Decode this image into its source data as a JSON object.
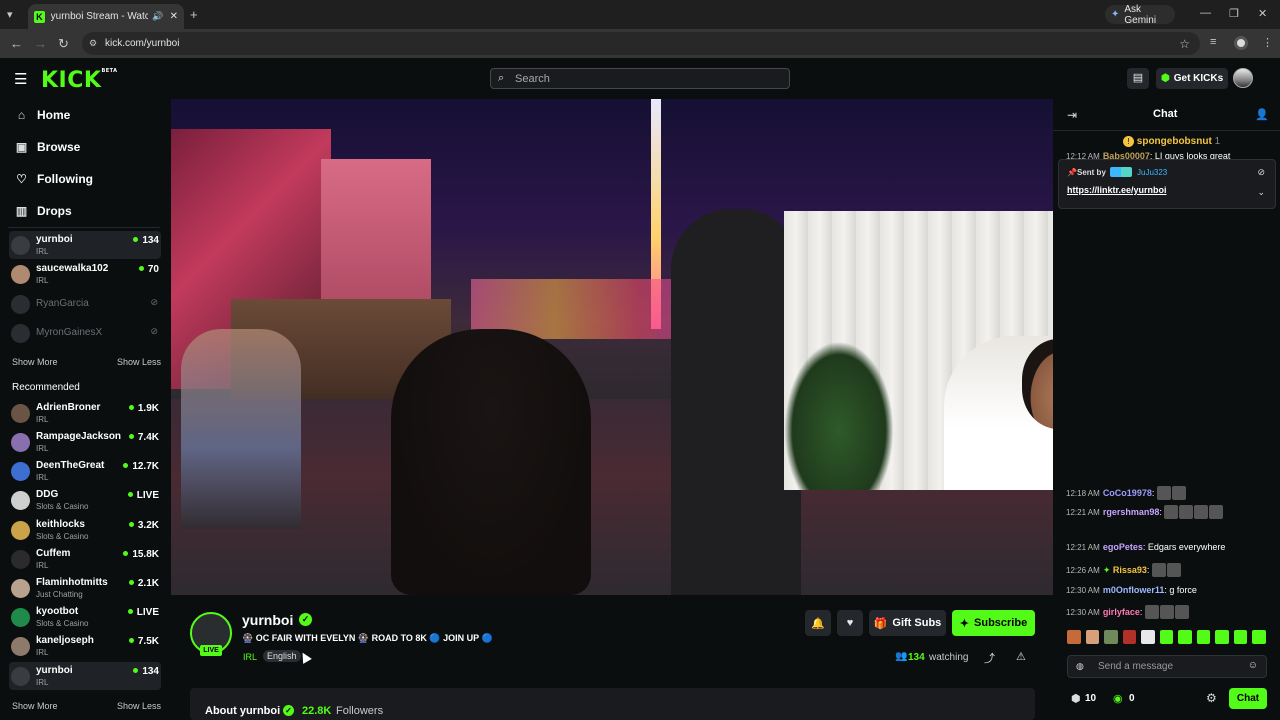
{
  "browser": {
    "tab_title": "yurnboi Stream - Watch Live",
    "url": "kick.com/yurnboi",
    "ask_gemini": "Ask Gemini"
  },
  "header": {
    "logo": "KICK",
    "logo_badge": "BETA",
    "search_placeholder": "Search",
    "get_kicks": "Get KICKs"
  },
  "sidebar": {
    "nav": [
      "Home",
      "Browse",
      "Following",
      "Drops"
    ],
    "following": [
      {
        "name": "yurnboi",
        "category": "IRL",
        "viewers": "134"
      },
      {
        "name": "saucewalka102",
        "category": "IRL",
        "viewers": "70"
      },
      {
        "name": "RyanGarcia",
        "category": "",
        "viewers": ""
      },
      {
        "name": "MyronGainesX",
        "category": "",
        "viewers": ""
      }
    ],
    "show_more": "Show More",
    "show_less": "Show Less",
    "recommended_heading": "Recommended",
    "recommended": [
      {
        "name": "AdrienBroner",
        "category": "IRL",
        "viewers": "1.9K"
      },
      {
        "name": "RampageJackson",
        "category": "IRL",
        "viewers": "7.4K"
      },
      {
        "name": "DeenTheGreat",
        "category": "IRL",
        "viewers": "12.7K"
      },
      {
        "name": "DDG",
        "category": "Slots & Casino",
        "viewers": "LIVE"
      },
      {
        "name": "keithlocks",
        "category": "Slots & Casino",
        "viewers": "3.2K"
      },
      {
        "name": "Cuffem",
        "category": "IRL",
        "viewers": "15.8K"
      },
      {
        "name": "Flaminhotmitts",
        "category": "Just Chatting",
        "viewers": "2.1K"
      },
      {
        "name": "kyootbot",
        "category": "Slots & Casino",
        "viewers": "LIVE"
      },
      {
        "name": "kaneljoseph",
        "category": "IRL",
        "viewers": "7.5K"
      },
      {
        "name": "yurnboi",
        "category": "IRL",
        "viewers": "134"
      }
    ]
  },
  "stream": {
    "streamer": "yurnboi",
    "live_badge": "LIVE",
    "title": "🎡 OC FAIR WITH EVELYN 🎡 ROAD TO 8K 🔵 JOIN UP 🔵",
    "category": "IRL",
    "language": "English",
    "viewers": "134",
    "watching_label": "watching",
    "gift_subs": "Gift Subs",
    "subscribe": "Subscribe",
    "about_label": "About yurnboi",
    "followers_count": "22.8K",
    "followers_label": "Followers"
  },
  "chat": {
    "title": "Chat",
    "pinned_gifter": "spongebobsnut",
    "pinned_gifter_count": "1",
    "partial_msg": {
      "time": "12:12 AM",
      "user": "Babs00007",
      "text": ": LI guys looks great"
    },
    "pinned_sent_by": "Sent by",
    "pinned_user": "JuJu323",
    "pinned_link": "https://linktr.ee/yurnboi",
    "messages": [
      {
        "time": "12:18 AM",
        "user": "CoCo19978",
        "text": ":",
        "color": "#9e9eff"
      },
      {
        "time": "12:21 AM",
        "user": "rgershman98",
        "text": ":",
        "color": "#c7a3ff"
      },
      {
        "time": "12:21 AM",
        "user": "egoPetes",
        "text": ": Edgars everywhere",
        "color": "#c7a3ff"
      },
      {
        "time": "12:26 AM",
        "user": "Rissa93",
        "text": ":",
        "color": "#f5c542"
      },
      {
        "time": "12:30 AM",
        "user": "m0Onflower11",
        "text": ": g force",
        "color": "#9eb8ff"
      },
      {
        "time": "12:30 AM",
        "user": "girlyface",
        "text": ":",
        "color": "#ff7ab6"
      }
    ],
    "input_placeholder": "Send a message",
    "kicks_count": "10",
    "points_count": "0",
    "chat_button": "Chat"
  }
}
